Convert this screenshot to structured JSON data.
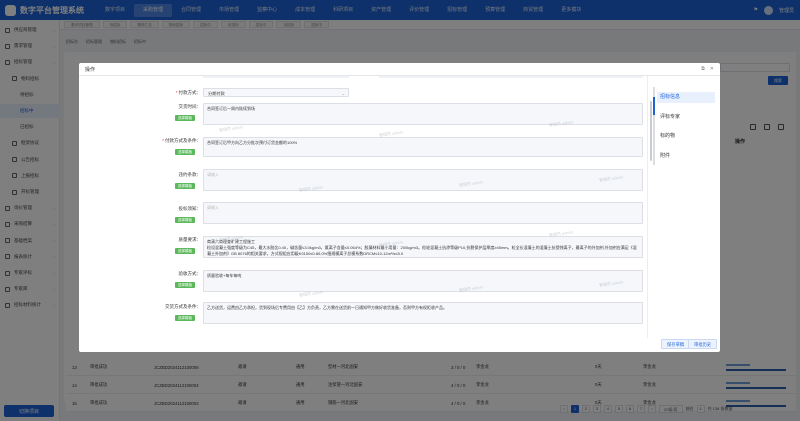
{
  "app": {
    "title": "数字平台管理系统",
    "user": "管理员",
    "nav": [
      "数字项目",
      "采购管理",
      "合同管理",
      "市场管理",
      "监察中心",
      "成本管理",
      "科研项目",
      "资产管理",
      "评价管理",
      "招标管理",
      "预算管理",
      "商贸管理",
      "更多模块"
    ],
    "active_nav": 1
  },
  "sidebar": {
    "items": [
      {
        "label": "供应商管理",
        "level": 0
      },
      {
        "label": "需求管理",
        "level": 0
      },
      {
        "label": "招标管理",
        "level": 0
      },
      {
        "label": "物料招标",
        "level": 1
      },
      {
        "label": "待招标",
        "level": 2
      },
      {
        "label": "招标中",
        "level": 2,
        "active": true
      },
      {
        "label": "已招标",
        "level": 2
      },
      {
        "label": "框架协议",
        "level": 1
      },
      {
        "label": "公告招标",
        "level": 1
      },
      {
        "label": "上报招标",
        "level": 1
      },
      {
        "label": "开标管理",
        "level": 1
      },
      {
        "label": "询价管理",
        "level": 0
      },
      {
        "label": "采购结算",
        "level": 0
      },
      {
        "label": "基础档案",
        "level": 0
      },
      {
        "label": "报表统计",
        "level": 0
      },
      {
        "label": "专家评标",
        "level": 0
      },
      {
        "label": "专家库",
        "level": 0
      },
      {
        "label": "招标材料统计",
        "level": 0
      }
    ],
    "switch_label": "切换项目"
  },
  "tabs": [
    "基本项目管理",
    "待招标",
    "需求汇总",
    "物料招标",
    "招标中",
    "待招标",
    "招标中",
    "待招标",
    "招标中"
  ],
  "breadcrumb": [
    "招标台",
    "招标管理",
    "物料招标",
    "招标中"
  ],
  "background_table": {
    "op_header": "操作",
    "rows": [
      {
        "no": "13",
        "status": "审批成功",
        "code": "JCZBD2024112100006",
        "method": "邀请",
        "type": "通用",
        "name": "型材—河北国安",
        "progress": "3 / 0 / 0",
        "person": "李金龙",
        "days": "0天",
        "owner": "李金龙"
      },
      {
        "no": "14",
        "status": "审批成功",
        "code": "JCZBD2024112100004",
        "method": "邀请",
        "type": "通用",
        "name": "注浆管—河北国安",
        "progress": "4 / 0 / 0",
        "person": "李金龙",
        "days": "0天",
        "owner": "李金龙"
      },
      {
        "no": "15",
        "status": "审批成功",
        "code": "JCZBD2024112100002",
        "method": "邀请",
        "type": "通用",
        "name": "钢筋—河北国安",
        "progress": "4 / 0 / 0",
        "person": "李金龙",
        "days": "0天",
        "owner": "李金龙"
      }
    ],
    "pager": {
      "pages": [
        "1",
        "2",
        "3",
        "4",
        "5",
        "6",
        "7"
      ],
      "current": "1",
      "page_size": "20条/页",
      "goto_label": "前往",
      "goto_value": "1",
      "total": "共 138 条数据"
    }
  },
  "modal": {
    "title": "操作",
    "watermark": "管理员 admin",
    "fields": [
      {
        "key": "payment_method",
        "label": "付款方式",
        "required": true,
        "kind": "select",
        "value": "分期付款"
      },
      {
        "key": "delivery_time",
        "label": "交货时间",
        "required": false,
        "kind": "textarea",
        "value": "合同签订后一周内陆续到场",
        "button": "选择模板"
      },
      {
        "key": "payment_terms",
        "label": "付款方式及条件",
        "required": true,
        "kind": "textarea",
        "value": "合同签订后甲方向乙方分批次预付订货金额的100%",
        "button": "选择模板"
      },
      {
        "key": "breach_terms",
        "label": "违约条款",
        "required": false,
        "kind": "textarea",
        "value": "",
        "placeholder": "请输入",
        "button": "选择模板"
      },
      {
        "key": "bid_notice",
        "label": "投标须知",
        "required": false,
        "kind": "textarea",
        "value": "",
        "placeholder": "请输入",
        "button": "选择模板"
      },
      {
        "key": "quality_req",
        "label": "质量要求",
        "required": false,
        "kind": "textarea",
        "value": "商清六商理查旷建工程施工\n粒设混凝土强度等级为C45，最大水胶比0.40，碱含量≤3.0kg/m3，氯离子含量≤0.064%；胶凝材料最小用量：200kg/m3。粒轮混凝土抗渗等级P10,抗裂保护层厚度≥45mm。粒全长混凝土的混凝土抗侵蚀离子，最离子的外加剂,外加剂应满足《混凝土外加剂》GB 8076的相关要求，方式规组应用级K0150≤0.85,0%细规模离子总模系数DRCM≤10-12m²/s≤5.0",
        "button": "选择模板"
      },
      {
        "key": "acceptance",
        "label": "验收方式",
        "required": false,
        "kind": "textarea",
        "value": "质量验收+每车每吨",
        "button": "选择模板"
      },
      {
        "key": "delivery_terms",
        "label": "交货方式及条件",
        "required": false,
        "kind": "textarea",
        "value": "乙方送货，运费由乙方承担，货到现场后专费用由【乙】方负责，乙方需在送货前一日通知甲方做好收货准备，否则甲方有权拒收产品。",
        "button": "选择模板"
      }
    ],
    "anchors": [
      "招标信息",
      "评标专家",
      "标的物",
      "附件"
    ],
    "active_anchor": 0,
    "footer": {
      "draft_label": "保存草稿",
      "submit_label": "审批历史"
    }
  }
}
